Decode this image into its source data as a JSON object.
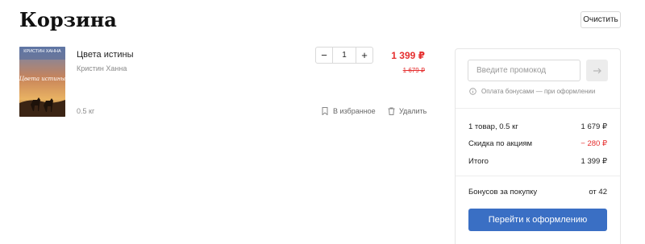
{
  "header": {
    "title": "Корзина",
    "clear_label": "Очистить"
  },
  "cart_item": {
    "cover": {
      "author_text": "КРИСТИН ХАННА",
      "title_text": "Цвета истины"
    },
    "title": "Цвета истины",
    "author": "Кристин Ханна",
    "weight": "0.5 кг",
    "quantity": "1",
    "decrement_label": "−",
    "increment_label": "+",
    "price_new": "1 399 ₽",
    "price_old": "1 679 ₽",
    "favorite_label": "В избранное",
    "delete_label": "Удалить"
  },
  "summary": {
    "promo_placeholder": "Введите промокод",
    "bonus_note": "Оплата бонусами — при оформлении",
    "items_label": "1 товар, 0.5 кг",
    "items_value": "1 679 ₽",
    "discount_label": "Скидка по акциям",
    "discount_value": "− 280 ₽",
    "total_label": "Итого",
    "total_value": "1 399 ₽",
    "bonus_label": "Бонусов за покупку",
    "bonus_value": "от 42",
    "checkout_label": "Перейти к оформлению"
  },
  "colors": {
    "accent": "#3a6fc4",
    "price_red": "#e52e2e"
  },
  "icons": [
    "minus-icon",
    "plus-icon",
    "bookmark-icon",
    "trash-icon",
    "arrow-right-icon",
    "info-icon"
  ]
}
